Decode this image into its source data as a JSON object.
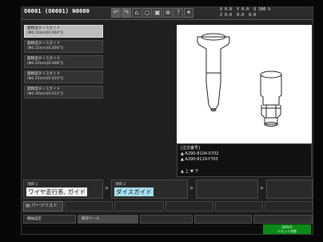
{
  "topbar": {
    "program": "O0001 (O0001) N0000",
    "coords": [
      "X  0.0",
      "Y  0.0",
      "Z  0.0",
      "U 100 %",
      "0.0",
      "0.0"
    ]
  },
  "tool_list": [
    {
      "name": "面精度ダイスガイド",
      "spec": "(Φ0.10mm[0.004\"])"
    },
    {
      "name": "面精度ダイスガイド",
      "spec": "(Φ0.15mm[0.006\"])"
    },
    {
      "name": "面精度ダイスガイド",
      "spec": "(Φ0.20mm[0.008\"])"
    },
    {
      "name": "面精度ダイスガイド",
      "spec": "(Φ0.25mm[0.010\"])"
    },
    {
      "name": "面精度ダイスガイド",
      "spec": "(Φ0.30mm[0.012\"])"
    }
  ],
  "info": {
    "heading": "[注文番号]",
    "lines": [
      "▲ A290-8104-X702",
      "▲ A290-8119-Y703"
    ],
    "nav": "▲ 上  ▼ 下"
  },
  "selection": {
    "item1_label": "項目 1",
    "item1_value": "ワイヤ走行系, ガイド",
    "item2_label": "項目 2",
    "item2_value": "ダイスガイド"
  },
  "parts_button": "パーツリスト",
  "tabs": [
    "機械設定",
    "保守ツール"
  ],
  "status_green": [
    "SERVO",
    "リセット状態"
  ]
}
